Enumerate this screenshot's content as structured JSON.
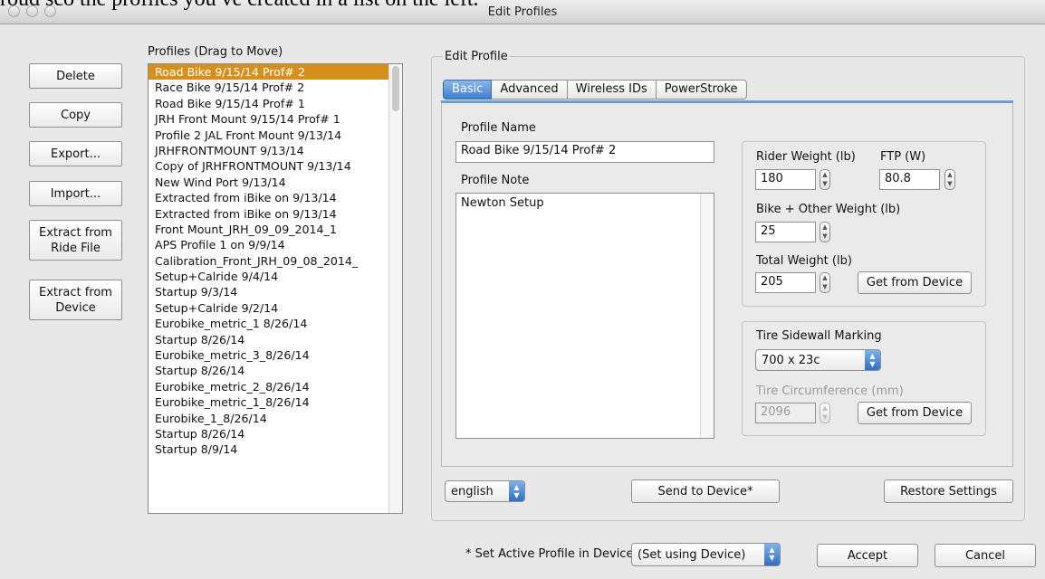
{
  "document_text": "roud sco the profiles you ve created in a list on the left.",
  "window": {
    "title": "Edit Profiles"
  },
  "sidebar_buttons": {
    "delete": "Delete",
    "copy": "Copy",
    "export": "Export...",
    "import": "Import...",
    "extract_ride_line1": "Extract from",
    "extract_ride_line2": "Ride File",
    "extract_device_line1": "Extract from",
    "extract_device_line2": "Device"
  },
  "profiles": {
    "header": "Profiles (Drag to Move)",
    "items": [
      "Road Bike 9/15/14 Prof# 2",
      "Race Bike 9/15/14 Prof# 2",
      "Road Bike 9/15/14 Prof# 1",
      "JRH Front Mount 9/15/14 Prof# 1",
      "Profile 2 JAL Front Mount 9/13/14",
      "JRHFRONTMOUNT 9/13/14",
      "Copy of JRHFRONTMOUNT 9/13/14",
      "New Wind Port 9/13/14",
      "Extracted from iBike on 9/13/14",
      "Extracted from iBike on 9/13/14",
      "Front Mount_JRH_09_09_2014_1",
      "APS Profile 1 on 9/9/14",
      "Calibration_Front_JRH_09_08_2014_",
      "Setup+Calride 9/4/14",
      "Startup 9/3/14",
      "Setup+Calride 9/2/14",
      "Eurobike_metric_1 8/26/14",
      "Startup 8/26/14",
      "Eurobike_metric_3_8/26/14",
      "Startup 8/26/14",
      "Eurobike_metric_2_8/26/14",
      "Eurobike_metric_1_8/26/14",
      "Eurobike_1_8/26/14",
      "Startup 8/26/14",
      "Startup 8/9/14"
    ]
  },
  "edit_profile": {
    "group_title": "Edit Profile",
    "tabs": [
      "Basic",
      "Advanced",
      "Wireless IDs",
      "PowerStroke"
    ],
    "active_tab": "Basic",
    "profile_name_label": "Profile Name",
    "profile_name_value": "Road Bike 9/15/14 Prof# 2",
    "profile_note_label": "Profile Note",
    "profile_note_value": "Newton Setup",
    "rider_weight_label": "Rider Weight (lb)",
    "rider_weight_value": "180",
    "ftp_label": "FTP (W)",
    "ftp_value": "80.8",
    "bike_weight_label": "Bike + Other Weight (lb)",
    "bike_weight_value": "25",
    "total_weight_label": "Total Weight (lb)",
    "total_weight_value": "205",
    "get_from_device_1": "Get from Device",
    "tire_label": "Tire Sidewall Marking",
    "tire_value": "700 x 23c",
    "circumference_label": "Tire Circumference (mm)",
    "circumference_value": "2096",
    "get_from_device_2": "Get from Device",
    "language_value": "english",
    "send_button": "Send to Device*",
    "restore_button": "Restore Settings"
  },
  "footer": {
    "active_profile_label": "* Set Active Profile in Device",
    "active_profile_value": "(Set using Device)",
    "accept": "Accept",
    "cancel": "Cancel"
  }
}
